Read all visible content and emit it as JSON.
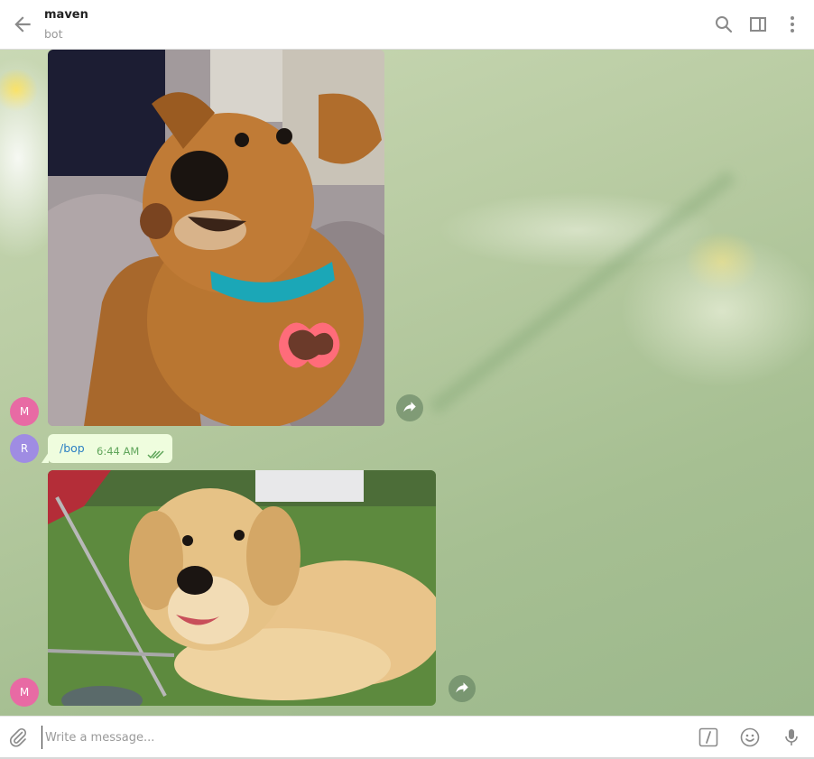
{
  "header": {
    "title": "maven",
    "subtitle": "bot",
    "icons": [
      "back-arrow-icon",
      "search-icon",
      "sidebar-panel-icon",
      "more-vertical-icon"
    ]
  },
  "messages": [
    {
      "type": "photo",
      "sender_initial": "M",
      "avatar_color": "#e86aa4",
      "content": "photo of a brown puppy with a teal collar and bone-shaped tag"
    },
    {
      "type": "text",
      "sender_initial": "R",
      "avatar_color": "#9f8ce3",
      "text": "/bop",
      "time": "6:44 AM",
      "status": "read"
    },
    {
      "type": "photo",
      "sender_initial": "M",
      "avatar_color": "#e86aa4",
      "content": "photo of a golden retriever puppy lying on grass"
    }
  ],
  "composer": {
    "placeholder": "Write a message...",
    "icons": [
      "paperclip-icon",
      "bot-command-icon",
      "emoji-icon",
      "microphone-icon"
    ]
  },
  "colors": {
    "bubble_out": "#effdde",
    "link": "#2b7fc3",
    "time_out": "#5fa55a",
    "avatar_m": "#e86aa4",
    "avatar_r": "#9f8ce3"
  }
}
